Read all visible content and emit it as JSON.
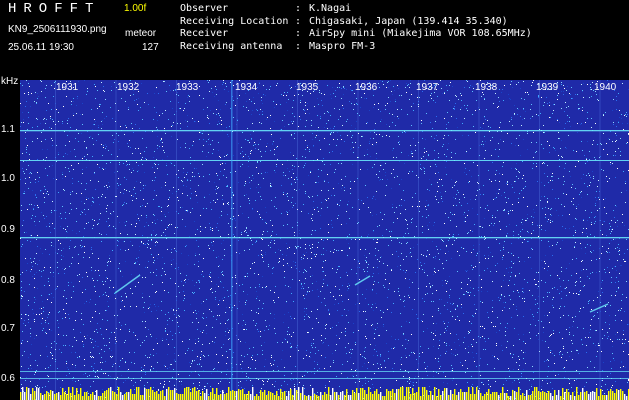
{
  "header": {
    "brand": "HROFFT",
    "version": "1.00f",
    "filename": "KN9_2506111930.png",
    "mode": "meteor",
    "datetime": "25.06.11 19:30",
    "count": "127",
    "info": [
      {
        "key": "Observer",
        "value": "K.Nagai"
      },
      {
        "key": "Receiving Location",
        "value": "Chigasaki, Japan (139.414 35.340)"
      },
      {
        "key": "Receiver",
        "value": "AirSpy mini (Miakejima VOR 108.65MHz)"
      },
      {
        "key": "Receiving antenna",
        "value": "Maspro FM-3"
      }
    ]
  },
  "axis": {
    "y_label": "kHz",
    "y_ticks": [
      "1.1",
      "1.0",
      "0.9",
      "0.8",
      "0.7",
      "0.6"
    ],
    "time_ticks": [
      "1931",
      "1932",
      "1933",
      "1934",
      "1935",
      "1936",
      "1937",
      "1938",
      "1939",
      "1940"
    ]
  },
  "colors": {
    "background": "#1f2aa8",
    "noise": "#3fa8ff",
    "carrier": "#6ff0ff",
    "baseline": "#ffff00"
  }
}
